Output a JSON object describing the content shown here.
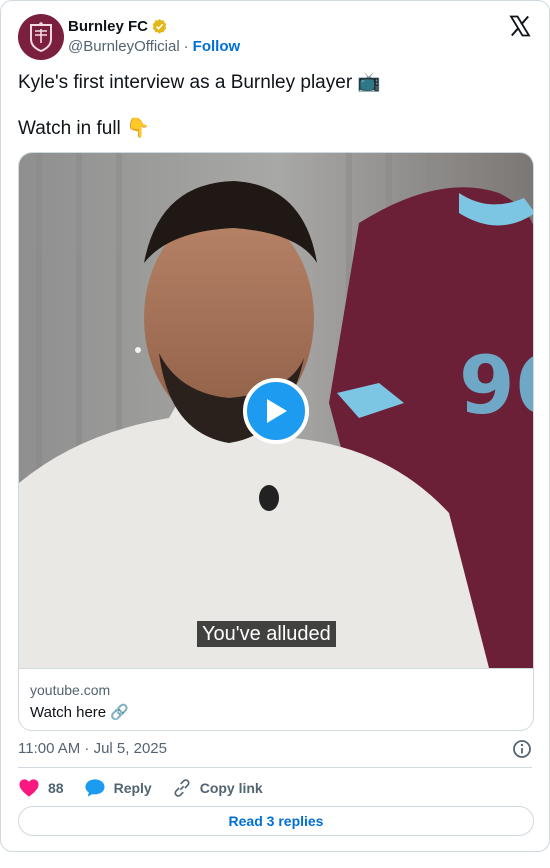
{
  "author": {
    "display_name": "Burnley FC",
    "handle": "@BurnleyOfficial",
    "separator": "·",
    "follow_label": "Follow",
    "verified_color": "#e2b719"
  },
  "tweet": {
    "line1": "Kyle's first interview as a Burnley player 📺",
    "line2": "Watch in full 👇"
  },
  "media": {
    "subtitle": "You've alluded",
    "play_icon": "play-icon"
  },
  "link_card": {
    "domain": "youtube.com",
    "title": "Watch here",
    "link_icon": "🔗"
  },
  "meta": {
    "timestamp": "11:00 AM · Jul 5, 2025"
  },
  "actions": {
    "like_count": "88",
    "reply_label": "Reply",
    "copy_label": "Copy link"
  },
  "footer": {
    "read_replies_label": "Read 3 replies"
  },
  "colors": {
    "accent": "#1d9bf0",
    "link": "#006fd6",
    "like": "#f91880",
    "club": "#7a1f3d"
  }
}
